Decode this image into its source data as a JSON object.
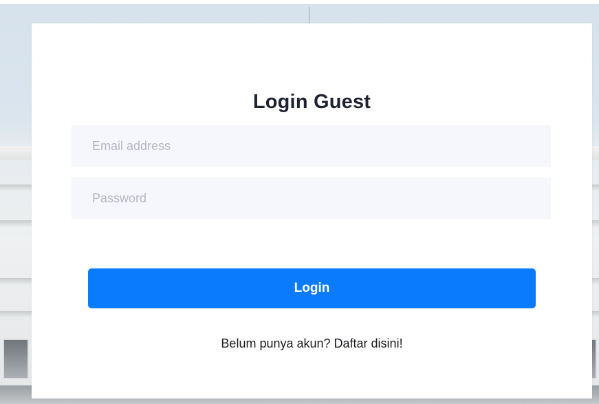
{
  "login_form": {
    "title": "Login Guest",
    "email": {
      "value": "",
      "placeholder": "Email address"
    },
    "password": {
      "value": "",
      "placeholder": "Password"
    },
    "submit_label": "Login",
    "register_prompt": "Belum punya akun? Daftar disini!"
  },
  "colors": {
    "primary_button": "#0b7bfd",
    "input_background": "#f6f6fd",
    "card_background": "#ffffff",
    "title_text": "#1f2233"
  }
}
